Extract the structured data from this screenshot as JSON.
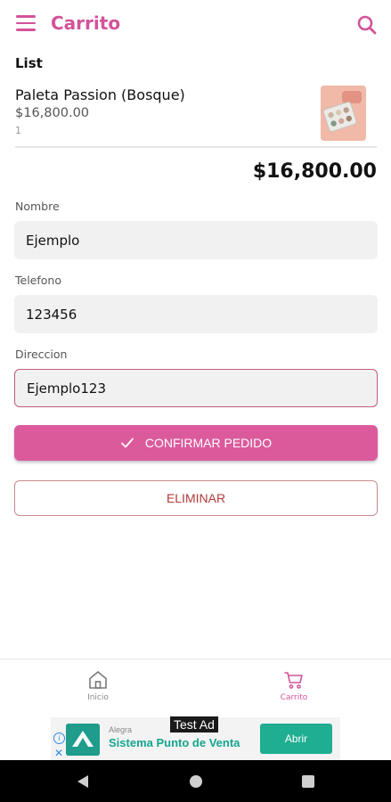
{
  "appbar": {
    "title": "Carrito",
    "menu_icon": "hamburger-menu-icon",
    "search_icon": "search-icon",
    "accent_color": "#d3539a"
  },
  "cart": {
    "heading": "List",
    "items": [
      {
        "name": "Paleta Passion (Bosque)",
        "price": "$16,800.00",
        "quantity": "1"
      }
    ],
    "total": "$16,800.00"
  },
  "form": {
    "name_label": "Nombre",
    "name_value": "Ejemplo",
    "phone_label": "Telefono",
    "phone_value": "123456",
    "address_label": "Direccion",
    "address_value": "Ejemplo123"
  },
  "actions": {
    "confirm_label": "CONFIRMAR PEDIDO",
    "confirm_icon": "check-icon",
    "confirm_color": "#db5a9c",
    "delete_label": "ELIMINAR",
    "delete_color": "#b03a3a"
  },
  "bottom_nav": {
    "items": [
      {
        "label": "Inicio",
        "icon": "home-icon"
      },
      {
        "label": "Carrito",
        "icon": "cart-icon",
        "selected": true
      }
    ]
  },
  "ad": {
    "label": "Test Ad",
    "brand": "Alegra",
    "title": "Sistema Punto de Venta",
    "cta": "Abrir",
    "info_icon": "ad-info-icon",
    "close_icon": "ad-close-icon"
  },
  "system_nav": {
    "back_icon": "back-triangle-icon",
    "home_icon": "home-circle-icon",
    "recents_icon": "recents-square-icon"
  }
}
